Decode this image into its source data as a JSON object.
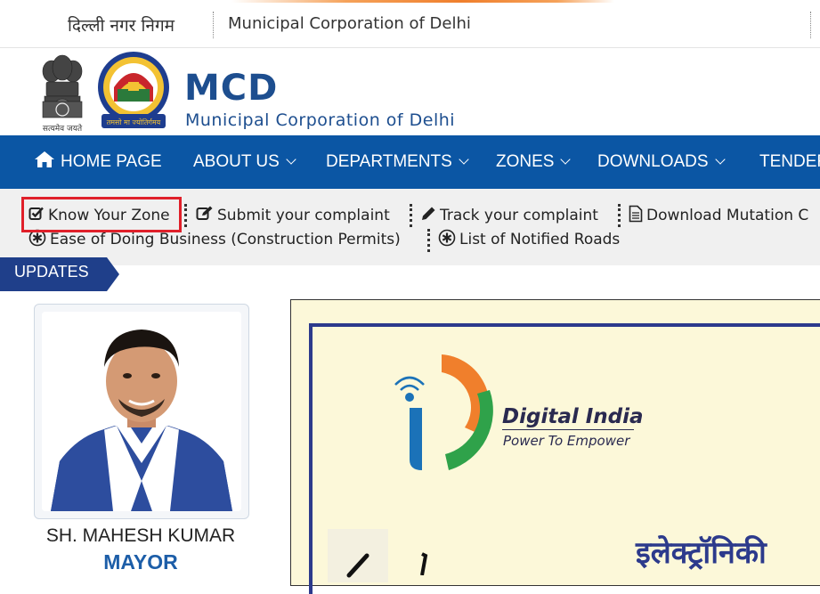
{
  "topbar": {
    "hindi_title": "दिल्ली नगर निगम",
    "english_title": "Municipal Corporation of Delhi"
  },
  "header": {
    "brand_title": "MCD",
    "brand_subtitle": "Municipal Corporation of Delhi",
    "emblem_caption": "सत्यमेव जयते",
    "seal_motto": "तमसो मा ज्योतिर्गमय"
  },
  "nav": {
    "items": [
      {
        "label": "HOME PAGE",
        "icon": "home-icon"
      },
      {
        "label": "ABOUT US",
        "icon": "chevron-down-icon"
      },
      {
        "label": "DEPARTMENTS",
        "icon": "chevron-down-icon"
      },
      {
        "label": "ZONES",
        "icon": "chevron-down-icon"
      },
      {
        "label": "DOWNLOADS",
        "icon": "chevron-down-icon"
      },
      {
        "label": "TENDER",
        "icon": "none"
      }
    ],
    "background": "#0b56a4"
  },
  "quick_links": {
    "items": [
      {
        "label": "Know Your Zone",
        "icon": "check-square-icon"
      },
      {
        "label": "Submit your complaint",
        "icon": "edit-icon"
      },
      {
        "label": "Track your complaint",
        "icon": "pencil-icon"
      },
      {
        "label": "Download Mutation C",
        "icon": "document-icon"
      },
      {
        "label": "Ease of Doing Business (Construction Permits)",
        "icon": "asterisk-circle-icon"
      },
      {
        "label": "List of Notified Roads",
        "icon": "asterisk-circle-icon"
      }
    ],
    "highlight_color": "#e0202a"
  },
  "updates": {
    "label": "UPDATES"
  },
  "mayor": {
    "name": "SH. MAHESH KUMAR",
    "title": "MAYOR"
  },
  "banner": {
    "logo_title": "Digital India",
    "logo_tagline": "Power To Empower",
    "hindi_text": "इलेक्ट्रॉनिकी"
  },
  "colors": {
    "brand_blue": "#1d4e8f",
    "accent_orange": "#f07f2c",
    "mayor_title_blue": "#1d5ea8"
  }
}
